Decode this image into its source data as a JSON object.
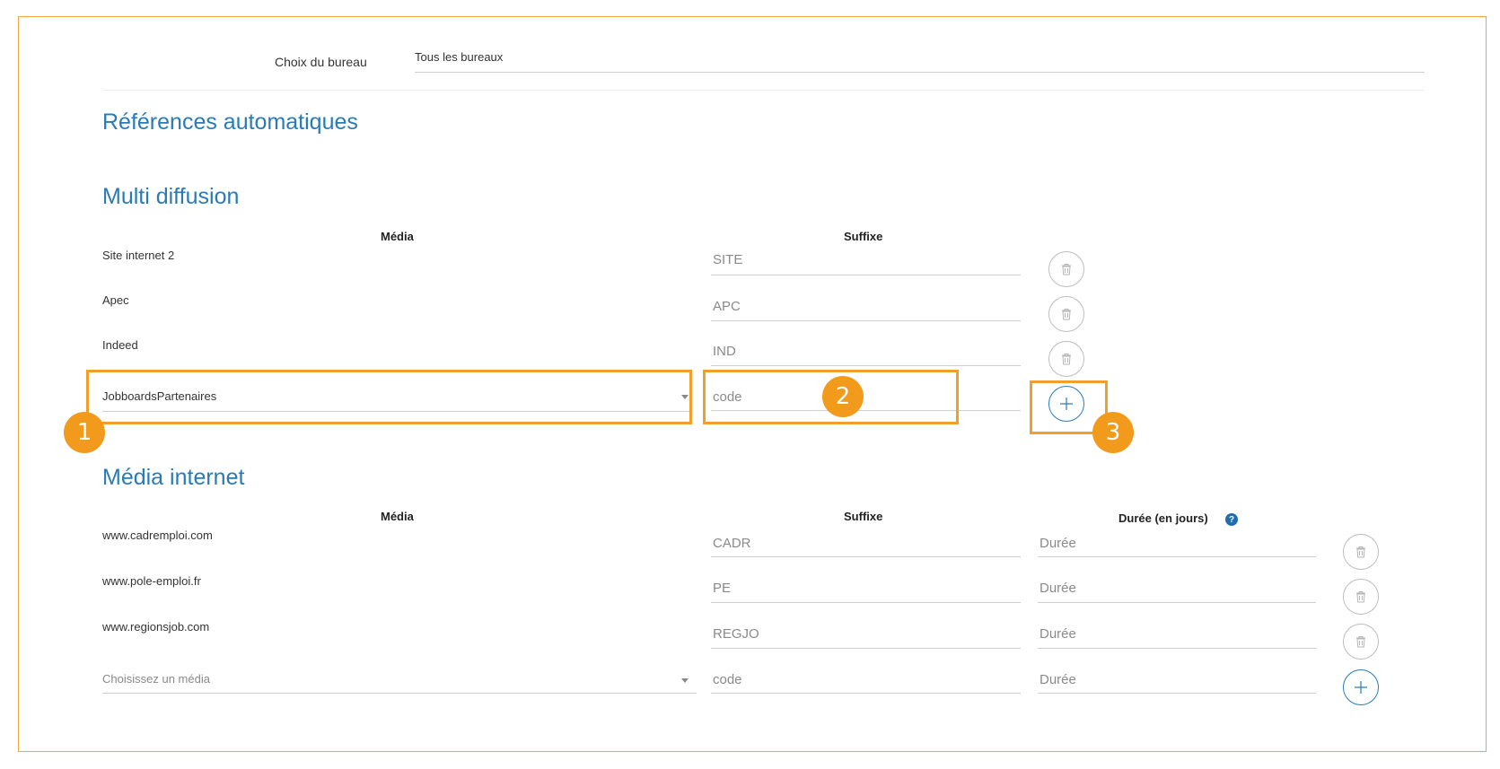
{
  "office": {
    "label": "Choix du bureau",
    "value": "Tous les bureaux"
  },
  "auto_refs": {
    "title": "Références automatiques"
  },
  "multi": {
    "title": "Multi diffusion",
    "col_media": "Média",
    "col_suffix": "Suffixe",
    "rows": [
      {
        "media": "Site internet 2",
        "suffix": "SITE"
      },
      {
        "media": "Apec",
        "suffix": "APC"
      },
      {
        "media": "Indeed",
        "suffix": "IND"
      }
    ],
    "new_row": {
      "media_value": "JobboardsPartenaires",
      "suffix_placeholder": "code"
    }
  },
  "internet": {
    "title": "Média internet",
    "col_media": "Média",
    "col_suffix": "Suffixe",
    "col_duration": "Durée (en jours)",
    "help_glyph": "?",
    "rows": [
      {
        "media": "www.cadremploi.com",
        "suffix": "CADR",
        "duration": "Durée"
      },
      {
        "media": "www.pole-emploi.fr",
        "suffix": "PE",
        "duration": "Durée"
      },
      {
        "media": "www.regionsjob.com",
        "suffix": "REGJO",
        "duration": "Durée"
      }
    ],
    "new_row": {
      "media_placeholder": "Choisissez un média",
      "suffix_placeholder": "code",
      "duration_placeholder": "Durée"
    }
  },
  "badges": [
    "1",
    "2",
    "3"
  ],
  "icons": {
    "delete": "trash-icon",
    "add": "plus-icon",
    "dropdown": "chevron-down-icon",
    "help": "help-icon"
  },
  "colors": {
    "accent_blue": "#2a7bb5",
    "highlight_orange": "#f0a02a",
    "badge_orange": "#f29a1c"
  }
}
